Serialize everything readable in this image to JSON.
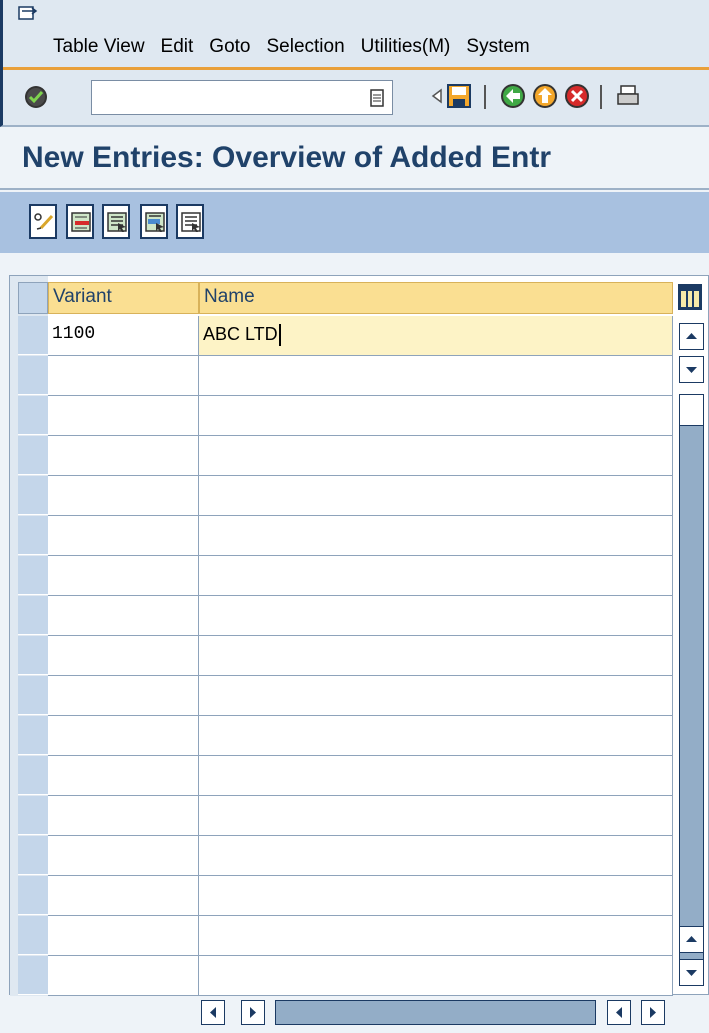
{
  "menu": {
    "items": [
      "Table View",
      "Edit",
      "Goto",
      "Selection",
      "Utilities(M)",
      "System"
    ]
  },
  "toolbar": {
    "command_field_value": "",
    "icons": [
      "enter-check-icon",
      "document-icon",
      "triangle-left-icon",
      "save-icon",
      "back-icon",
      "exit-icon",
      "cancel-icon",
      "print-icon"
    ]
  },
  "title": "New Entries: Overview of Added Entr",
  "app_toolbar": {
    "icons": [
      "change-display-icon",
      "delete-icon",
      "select-all-icon",
      "select-block-icon",
      "deselect-all-icon"
    ]
  },
  "table": {
    "columns": [
      "Variant",
      "Name"
    ],
    "rows": [
      {
        "variant": "1100",
        "name": "ABC LTD"
      },
      {
        "variant": "",
        "name": ""
      },
      {
        "variant": "",
        "name": ""
      },
      {
        "variant": "",
        "name": ""
      },
      {
        "variant": "",
        "name": ""
      },
      {
        "variant": "",
        "name": ""
      },
      {
        "variant": "",
        "name": ""
      },
      {
        "variant": "",
        "name": ""
      },
      {
        "variant": "",
        "name": ""
      },
      {
        "variant": "",
        "name": ""
      },
      {
        "variant": "",
        "name": ""
      },
      {
        "variant": "",
        "name": ""
      },
      {
        "variant": "",
        "name": ""
      },
      {
        "variant": "",
        "name": ""
      },
      {
        "variant": "",
        "name": ""
      },
      {
        "variant": "",
        "name": ""
      },
      {
        "variant": "",
        "name": ""
      }
    ]
  },
  "colors": {
    "title": "#20426a",
    "header_cell": "#fadf92",
    "active_cell": "#fdf3c6",
    "app_toolbar": "#a8c1e0",
    "menu_underline": "#e9a03a"
  }
}
